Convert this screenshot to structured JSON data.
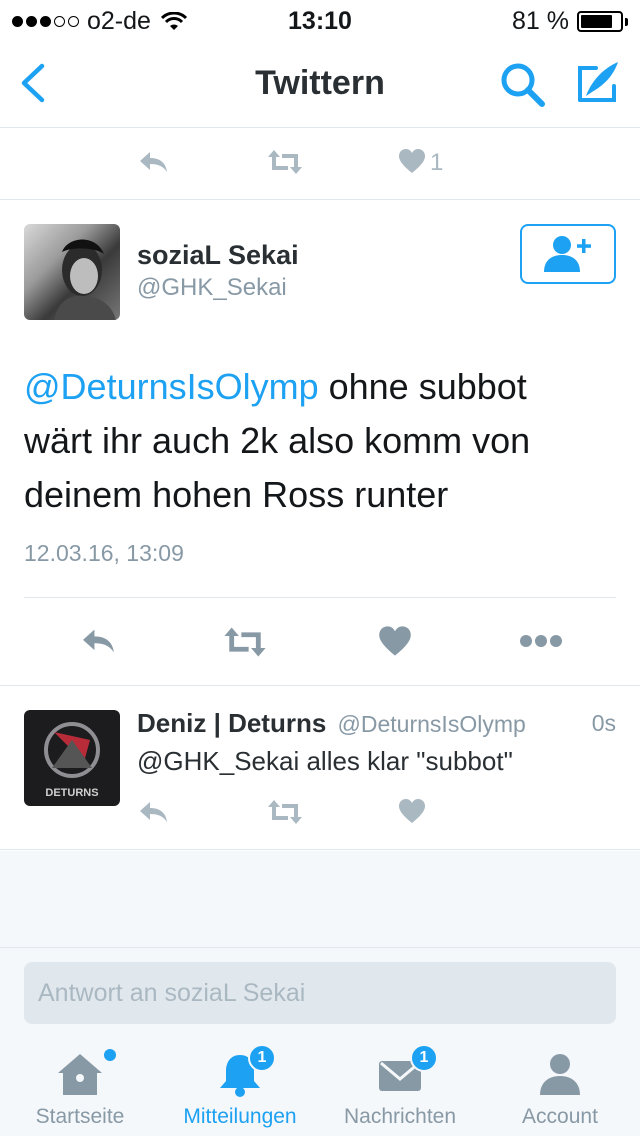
{
  "status_bar": {
    "carrier": "o2-de",
    "time": "13:10",
    "battery_text": "81 %",
    "battery_level": 0.81
  },
  "nav": {
    "title": "Twittern"
  },
  "prev_tweet": {
    "like_count": "1"
  },
  "tweet": {
    "author_name": "soziaL Sekai",
    "author_handle": "@GHK_Sekai",
    "mention": "@DeturnsIsOlymp",
    "text": " ohne subbot wärt ihr auch 2k also komm von deinem hohen Ross runter",
    "date": "12.03.16, 13:09"
  },
  "reply": {
    "author_name": "Deniz | Deturns",
    "author_handle": "@DeturnsIsOlymp",
    "time": "0s",
    "text": "@GHK_Sekai alles klar \"subbot\"",
    "avatar_text": "DETURNS"
  },
  "compose": {
    "placeholder": "Antwort an soziaL Sekai"
  },
  "tabs": [
    {
      "label": "Startseite",
      "icon": "home-icon"
    },
    {
      "label": "Mitteilungen",
      "icon": "bell-icon",
      "badge": "1"
    },
    {
      "label": "Nachrichten",
      "icon": "envelope-icon",
      "badge": "1"
    },
    {
      "label": "Account",
      "icon": "person-icon"
    }
  ],
  "colors": {
    "accent": "#1da1f2",
    "icon_gray": "#8899a6",
    "light_gray": "#aab8c2"
  }
}
